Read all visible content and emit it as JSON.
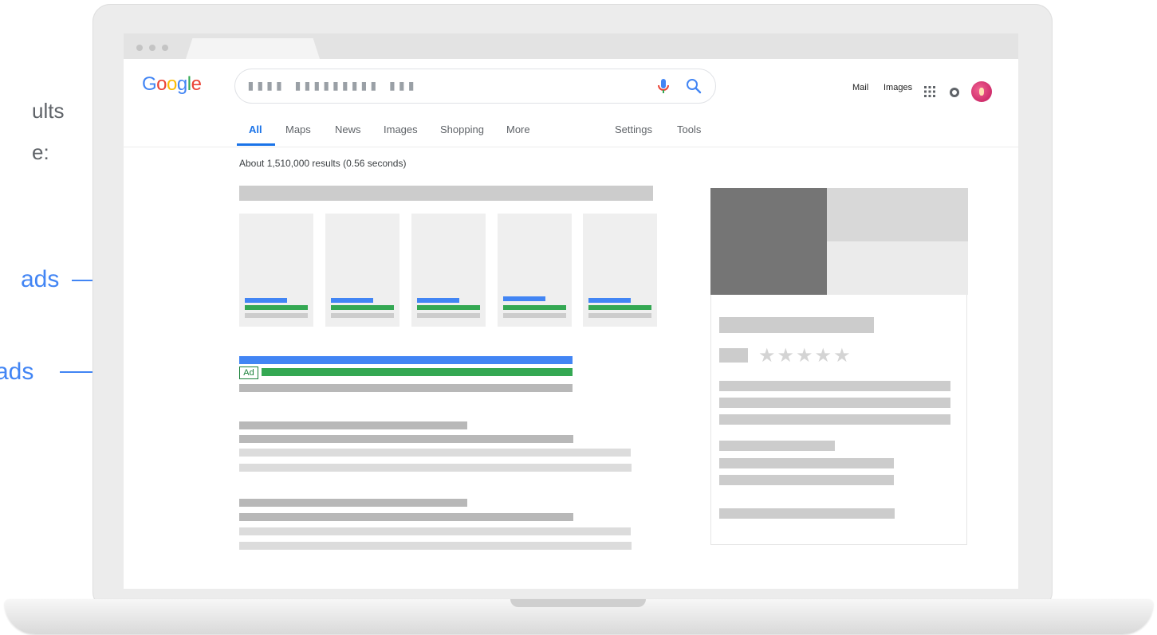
{
  "side_text": {
    "line1": "ults",
    "line2": "e:"
  },
  "callouts": {
    "shopping_ads": "ads",
    "text_ads": "ads"
  },
  "google": {
    "logo": {
      "letters": [
        "G",
        "o",
        "o",
        "g",
        "l",
        "e"
      ],
      "colors": [
        "#4285f4",
        "#ea4335",
        "#fbbc05",
        "#4285f4",
        "#34a853",
        "#ea4335"
      ]
    },
    "search": {
      "masked_query": "▮▮▮▮ ▮▮▮▮▮▮▮▮▮ ▮▮▮"
    },
    "header_links": {
      "mail": "Mail",
      "images": "Images"
    },
    "tabs": [
      "All",
      "Maps",
      "News",
      "Images",
      "Shopping",
      "More"
    ],
    "tools": [
      "Settings",
      "Tools"
    ],
    "result_stats": "About 1,510,000 results (0.56 seconds)",
    "ad_badge": "Ad",
    "rating_stars": "★★★★★"
  },
  "colors": {
    "accent_blue": "#4285f4",
    "ad_green": "#34a853",
    "active_tab": "#1a73e8"
  }
}
